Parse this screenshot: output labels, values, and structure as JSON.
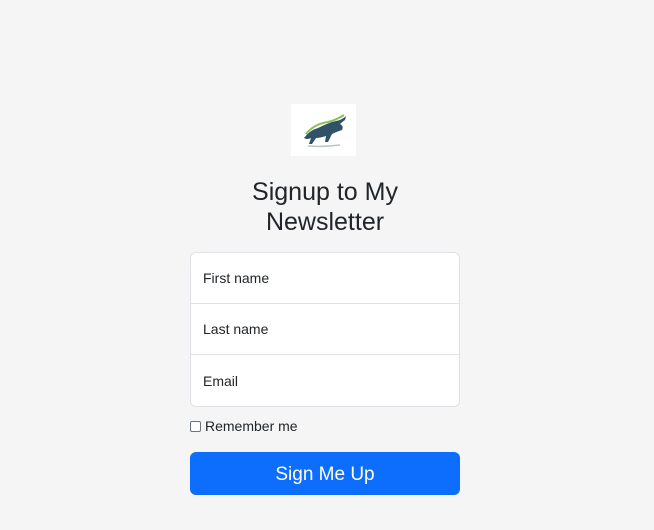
{
  "logo": {
    "icon": "bull-logo-icon"
  },
  "heading": {
    "title": "Signup to My Newsletter"
  },
  "form": {
    "first_name_placeholder": "First name",
    "last_name_placeholder": "Last name",
    "email_placeholder": "Email",
    "remember_label": "Remember me",
    "submit_label": "Sign Me Up"
  },
  "colors": {
    "background": "#f5f5f5",
    "primary": "#0d6efd",
    "text": "#212529",
    "border": "#dee2e6"
  }
}
